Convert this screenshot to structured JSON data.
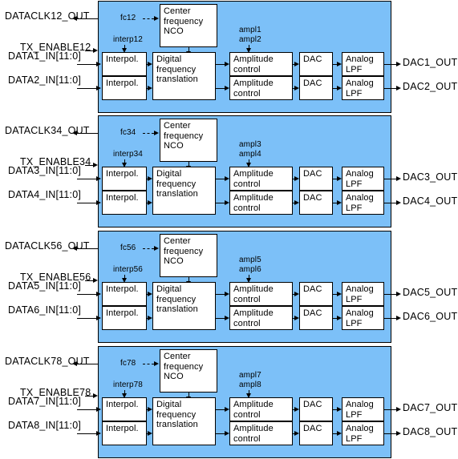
{
  "diagram": {
    "title": "Eight-channel digital up-converter / DAC transmit chain block diagram",
    "panel_color": "#7cc0f8",
    "box_color": "#ffffff",
    "line_color": "#000000",
    "block_labels": {
      "nco": "Center\nfrequency\nNCO",
      "nco_line1": "Center",
      "nco_line2": "frequency",
      "nco_line3": "NCO",
      "interpol": "Interpol.",
      "dft_line1": "Digital",
      "dft_line2": "frequency",
      "dft_line3": "translation",
      "ampl_line1": "Amplitude",
      "ampl_line2": "control",
      "dac": "DAC",
      "lpf_line1": "Analog",
      "lpf_line2": "LPF"
    },
    "channels": [
      {
        "id": "ch12",
        "dataclk_out": "DATACLK12_OUT",
        "tx_enable": "TX_ENABLE12",
        "data_in_a": "DATA1_IN[11:0]",
        "data_in_b": "DATA2_IN[11:0]",
        "fc": "fc12",
        "interp": "interp12",
        "ampl_a": "ampl1",
        "ampl_b": "ampl2",
        "dac_out_a": "DAC1_OUT",
        "dac_out_b": "DAC2_OUT"
      },
      {
        "id": "ch34",
        "dataclk_out": "DATACLK34_OUT",
        "tx_enable": "TX_ENABLE34",
        "data_in_a": "DATA3_IN[11:0]",
        "data_in_b": "DATA4_IN[11:0]",
        "fc": "fc34",
        "interp": "interp34",
        "ampl_a": "ampl3",
        "ampl_b": "ampl4",
        "dac_out_a": "DAC3_OUT",
        "dac_out_b": "DAC4_OUT"
      },
      {
        "id": "ch56",
        "dataclk_out": "DATACLK56_OUT",
        "tx_enable": "TX_ENABLE56",
        "data_in_a": "DATA5_IN[11:0]",
        "data_in_b": "DATA6_IN[11:0]",
        "fc": "fc56",
        "interp": "interp56",
        "ampl_a": "ampl5",
        "ampl_b": "ampl6",
        "dac_out_a": "DAC5_OUT",
        "dac_out_b": "DAC6_OUT"
      },
      {
        "id": "ch78",
        "dataclk_out": "DATACLK78_OUT",
        "tx_enable": "TX_ENABLE78",
        "data_in_a": "DATA7_IN[11:0]",
        "data_in_b": "DATA8_IN[11:0]",
        "fc": "fc78",
        "interp": "interp78",
        "ampl_a": "ampl7",
        "ampl_b": "ampl8",
        "dac_out_a": "DAC7_OUT",
        "dac_out_b": "DAC8_OUT"
      }
    ]
  }
}
